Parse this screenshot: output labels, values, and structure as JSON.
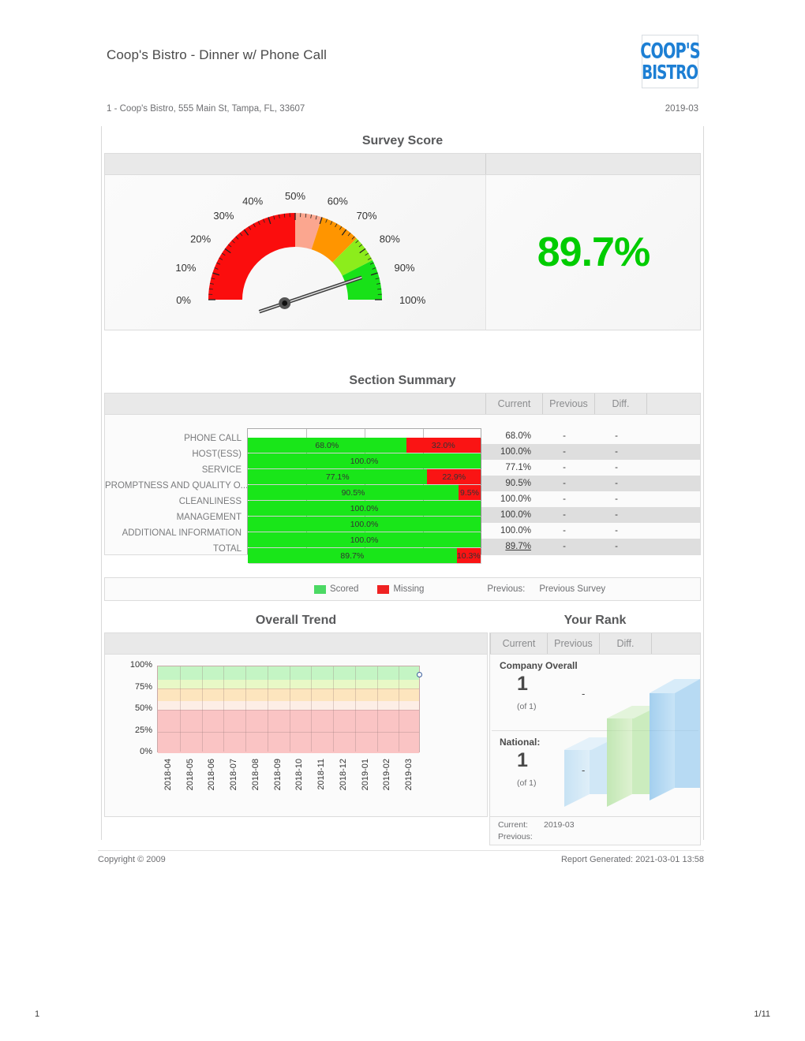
{
  "header": {
    "title": "Coop's Bistro - Dinner w/ Phone Call",
    "location": "1 - Coop's Bistro, 555 Main St, Tampa, FL, 33607",
    "period": "2019-03",
    "logo_line1": "COOP'S",
    "logo_line2": "BISTRO"
  },
  "survey_score": {
    "panel_title": "Survey Score",
    "score_label": "89.7%",
    "score_value": 89.7,
    "score_color": "#00cc00",
    "gauge_ticks": [
      "0%",
      "10%",
      "20%",
      "30%",
      "40%",
      "50%",
      "60%",
      "70%",
      "80%",
      "90%",
      "100%"
    ],
    "gauge_bands": [
      {
        "from": 0,
        "to": 50,
        "color": "#fb0d0d"
      },
      {
        "from": 50,
        "to": 60,
        "color": "#fba68f"
      },
      {
        "from": 60,
        "to": 75,
        "color": "#ff9500"
      },
      {
        "from": 75,
        "to": 85,
        "color": "#8ced1c"
      },
      {
        "from": 85,
        "to": 100,
        "color": "#18e118"
      }
    ]
  },
  "section_summary": {
    "panel_title": "Section Summary",
    "columns": [
      "Current",
      "Previous",
      "Diff."
    ],
    "rows": [
      {
        "label": "PHONE CALL",
        "scored": 68.0,
        "missing": 32.0,
        "scored_label": "68.0%",
        "missing_label": "32.0%",
        "current": "68.0%",
        "previous": "-",
        "diff": "-"
      },
      {
        "label": "HOST(ESS)",
        "scored": 100.0,
        "missing": 0.0,
        "scored_label": "100.0%",
        "missing_label": "",
        "current": "100.0%",
        "previous": "-",
        "diff": "-"
      },
      {
        "label": "SERVICE",
        "scored": 77.1,
        "missing": 22.9,
        "scored_label": "77.1%",
        "missing_label": "22.9%",
        "current": "77.1%",
        "previous": "-",
        "diff": "-"
      },
      {
        "label": "PROMPTNESS AND QUALITY O...",
        "scored": 90.5,
        "missing": 9.5,
        "scored_label": "90.5%",
        "missing_label": "9.5%",
        "current": "90.5%",
        "previous": "-",
        "diff": "-"
      },
      {
        "label": "CLEANLINESS",
        "scored": 100.0,
        "missing": 0.0,
        "scored_label": "100.0%",
        "missing_label": "",
        "current": "100.0%",
        "previous": "-",
        "diff": "-"
      },
      {
        "label": "MANAGEMENT",
        "scored": 100.0,
        "missing": 0.0,
        "scored_label": "100.0%",
        "missing_label": "",
        "current": "100.0%",
        "previous": "-",
        "diff": "-"
      },
      {
        "label": "ADDITIONAL INFORMATION",
        "scored": 100.0,
        "missing": 0.0,
        "scored_label": "100.0%",
        "missing_label": "",
        "current": "100.0%",
        "previous": "-",
        "diff": "-"
      },
      {
        "label": "TOTAL",
        "scored": 89.7,
        "missing": 10.3,
        "scored_label": "89.7%",
        "missing_label": "10.3%",
        "current": "89.7%",
        "previous": "-",
        "diff": "-",
        "total": true
      }
    ],
    "legend": {
      "scored": "Scored",
      "missing": "Missing",
      "previous_label": "Previous:",
      "previous_value": "Previous Survey",
      "scored_color": "#4cd964",
      "missing_color": "#ef2222"
    }
  },
  "chart_data": [
    {
      "type": "bar",
      "title": "Section Summary",
      "orientation": "horizontal",
      "stacked": true,
      "categories": [
        "PHONE CALL",
        "HOST(ESS)",
        "SERVICE",
        "PROMPTNESS AND QUALITY O...",
        "CLEANLINESS",
        "MANAGEMENT",
        "ADDITIONAL INFORMATION",
        "TOTAL"
      ],
      "series": [
        {
          "name": "Scored",
          "values": [
            68.0,
            100.0,
            77.1,
            90.5,
            100.0,
            100.0,
            100.0,
            89.7
          ],
          "color": "#19e619"
        },
        {
          "name": "Missing",
          "values": [
            32.0,
            0.0,
            22.9,
            9.5,
            0.0,
            0.0,
            0.0,
            10.3
          ],
          "color": "#fa1414"
        }
      ],
      "xlim": [
        0,
        100
      ],
      "xlabel": "",
      "ylabel": "",
      "grid": true,
      "legend_position": "bottom"
    },
    {
      "type": "line",
      "title": "Overall Trend",
      "x": [
        "2018-04",
        "2018-05",
        "2018-06",
        "2018-07",
        "2018-08",
        "2018-09",
        "2018-10",
        "2018-11",
        "2018-12",
        "2019-01",
        "2019-02",
        "2019-03"
      ],
      "series": [
        {
          "name": "Overall Score",
          "values": [
            null,
            null,
            null,
            null,
            null,
            null,
            null,
            null,
            null,
            null,
            null,
            89.7
          ]
        }
      ],
      "ylim": [
        0,
        100
      ],
      "ytick_labels": [
        "0%",
        "25%",
        "50%",
        "75%",
        "100%"
      ],
      "ytick_values": [
        0,
        25,
        50,
        75,
        100
      ],
      "xlabel": "",
      "ylabel": "",
      "grid": true,
      "background_bands": [
        {
          "from": 0,
          "to": 50,
          "color": "#fac4c4"
        },
        {
          "from": 50,
          "to": 60,
          "color": "#fdeee6"
        },
        {
          "from": 60,
          "to": 75,
          "color": "#fde5be"
        },
        {
          "from": 75,
          "to": 85,
          "color": "#e8f8c6"
        },
        {
          "from": 85,
          "to": 100,
          "color": "#c4f5c4"
        }
      ],
      "marker_color": "#3b5f9e"
    },
    {
      "type": "gauge",
      "title": "Survey Score",
      "value": 89.7,
      "value_label": "89.7%",
      "min": 0,
      "max": 100,
      "tick_labels": [
        "0%",
        "10%",
        "20%",
        "30%",
        "40%",
        "50%",
        "60%",
        "70%",
        "80%",
        "90%",
        "100%"
      ],
      "bands": [
        {
          "from": 0,
          "to": 50,
          "color": "#fb0d0d"
        },
        {
          "from": 50,
          "to": 60,
          "color": "#fba68f"
        },
        {
          "from": 60,
          "to": 75,
          "color": "#ff9500"
        },
        {
          "from": 75,
          "to": 85,
          "color": "#8ced1c"
        },
        {
          "from": 85,
          "to": 100,
          "color": "#18e118"
        }
      ]
    }
  ],
  "overall_trend": {
    "panel_title": "Overall Trend"
  },
  "your_rank": {
    "panel_title": "Your Rank",
    "columns": [
      "Current",
      "Previous",
      "Diff."
    ],
    "company": {
      "title": "Company Overall",
      "rank": "1",
      "of": "(of 1)",
      "diff": "-"
    },
    "national": {
      "title": "National:",
      "rank": "1",
      "of": "(of 1)",
      "diff": "-"
    },
    "footer": {
      "current_label": "Current:",
      "current_value": "2019-03",
      "previous_label": "Previous:",
      "previous_value": ""
    }
  },
  "footer": {
    "copyright": "Copyright © 2009",
    "generated": "Report Generated: 2021-03-01 13:58",
    "page_left": "1",
    "page_right": "1/11"
  }
}
